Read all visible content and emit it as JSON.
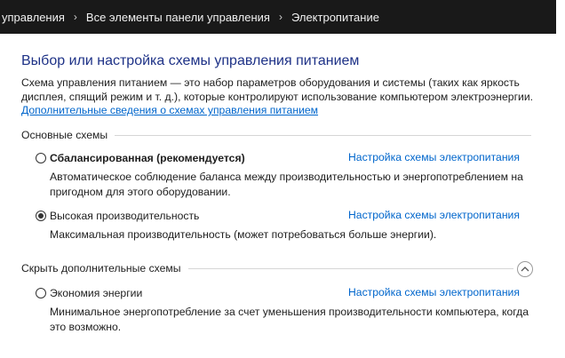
{
  "breadcrumb": {
    "items": [
      "управления",
      "Все элементы панели управления",
      "Электропитание"
    ],
    "separator": "›"
  },
  "page": {
    "title": "Выбор или настройка схемы управления питанием",
    "description": "Схема управления питанием — это набор параметров оборудования и системы (таких как яркость дисплея, спящий режим и т. д.), которые контролируют использование компьютером электроэнергии.",
    "details_link": "Дополнительные сведения о схемах управления питанием"
  },
  "main_plans": {
    "label": "Основные схемы",
    "plans": [
      {
        "name": "Сбалансированная (рекомендуется)",
        "selected": false,
        "link": "Настройка схемы электропитания",
        "description": "Автоматическое соблюдение баланса между производительностью и энергопотреблением на пригодном для этого оборудовании."
      },
      {
        "name": "Высокая производительность",
        "selected": true,
        "link": "Настройка схемы электропитания",
        "description": "Максимальная производительность (может потребоваться больше энергии)."
      }
    ]
  },
  "extra_plans": {
    "label": "Скрыть дополнительные схемы",
    "plans": [
      {
        "name": "Экономия энергии",
        "selected": false,
        "link": "Настройка схемы электропитания",
        "description": "Минимальное энергопотребление за счет уменьшения производительности компьютера, когда это возможно."
      }
    ]
  },
  "colors": {
    "address_bar": "#191919",
    "title": "#1e3287",
    "link": "#0066cc"
  }
}
